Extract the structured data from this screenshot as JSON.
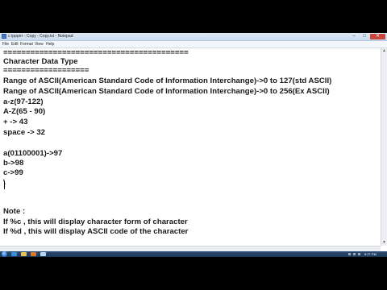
{
  "window": {
    "title": "c:\\ppprrr - Copy - Copy.txt - Notepad",
    "min": "–",
    "max": "□",
    "close": "✕"
  },
  "menu": [
    "File",
    "Edit",
    "Format",
    "View",
    "Help"
  ],
  "editor_lines": [
    "=========================================",
    "Character Data Type",
    "===================",
    "Range of ASCII(American Standard Code of Information Interchange)->0 to 127(std ASCII)",
    "Range of ASCII(American Standard Code of Information Interchange)->0 to 256(Ex ASCII)",
    "a-z(97-122)",
    "A-Z(65 - 90)",
    "+ -> 43",
    "space -> 32",
    "",
    "a(01100001)->97",
    "b->98",
    "c->99",
    "\\",
    "",
    "",
    "",
    "Note :",
    "If %c , this will display character form of character",
    "If %d , this will display ASCII code of the character"
  ],
  "taskbar": {
    "clock": "8:27 PM",
    "start_icon": "windows-orb-icon",
    "apps": [
      {
        "icon": "internet-explorer-icon",
        "color": "#3b8fd8"
      },
      {
        "icon": "folder-icon",
        "color": "#e8c15a"
      },
      {
        "icon": "media-player-icon",
        "color": "#e07a2a"
      },
      {
        "icon": "notepad-icon",
        "color": "#bcd7f0"
      }
    ]
  },
  "scroll": {
    "up": "▲",
    "down": "▼"
  }
}
